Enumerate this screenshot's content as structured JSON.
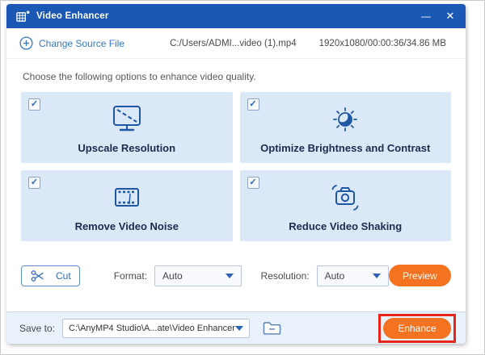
{
  "window": {
    "title": "Video Enhancer",
    "minimize_glyph": "—",
    "close_glyph": "✕"
  },
  "source": {
    "change_label": "Change Source File",
    "file_path": "C:/Users/ADMI...video (1).mp4",
    "file_info": "1920x1080/00:00:36/34.86 MB"
  },
  "instruction": "Choose the following options to enhance video quality.",
  "glyphs": {
    "check": "✓"
  },
  "options": [
    {
      "label": "Upscale Resolution",
      "checked": true,
      "icon": "monitor-upscale-icon"
    },
    {
      "label": "Optimize Brightness and Contrast",
      "checked": true,
      "icon": "brightness-sun-icon"
    },
    {
      "label": "Remove Video Noise",
      "checked": true,
      "icon": "film-strip-icon"
    },
    {
      "label": "Reduce Video Shaking",
      "checked": true,
      "icon": "camera-shake-icon"
    }
  ],
  "toolbar": {
    "cut_label": "Cut",
    "format_label": "Format:",
    "format_value": "Auto",
    "resolution_label": "Resolution:",
    "resolution_value": "Auto",
    "preview_label": "Preview"
  },
  "footer": {
    "save_to_label": "Save to:",
    "save_path": "C:\\AnyMP4 Studio\\A...ate\\Video Enhancer",
    "enhance_label": "Enhance"
  },
  "colors": {
    "titlebar_blue": "#1b57b4",
    "accent_blue": "#2f6cbe",
    "icon_blue": "#1f57a5",
    "card_background": "#dbe8f8",
    "action_orange": "#f57220",
    "annotation_red": "#e8251b"
  }
}
